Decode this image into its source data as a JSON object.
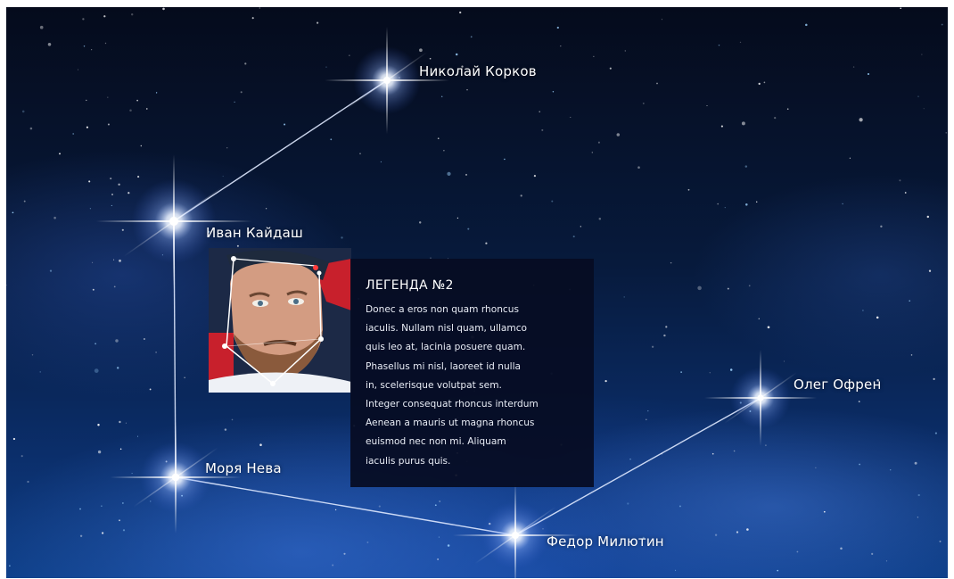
{
  "stars": [
    {
      "id": "nikolay",
      "label": "Николай Корков"
    },
    {
      "id": "ivan",
      "label": "Иван Кайдаш"
    },
    {
      "id": "morya",
      "label": "Моря Нева"
    },
    {
      "id": "fedor",
      "label": "Федор Милютин"
    },
    {
      "id": "oleg",
      "label": "Олег Офрен"
    }
  ],
  "legend": {
    "title": "ЛЕГЕНДА №2",
    "lines": [
      "Donec a eros non quam rhoncus",
      "iaculis. Nullam nisl quam, ullamco",
      "quis leo at, lacinia posuere quam.",
      "Phasellus mi nisl, laoreet id nulla",
      "in, scelerisque volutpat sem.",
      "Integer consequat rhoncus interdum",
      "Aenean a mauris ut magna rhoncus",
      "euismod nec non mi. Aliquam",
      "iaculis purus quis."
    ]
  },
  "colors": {
    "card_background": "#060c22",
    "constellation_line": "#dfe9ff",
    "star_glow": "#bcd2ff"
  },
  "icons": {
    "photo": "portrait-photo",
    "face_mesh": "face-tracking-mesh-icon"
  }
}
